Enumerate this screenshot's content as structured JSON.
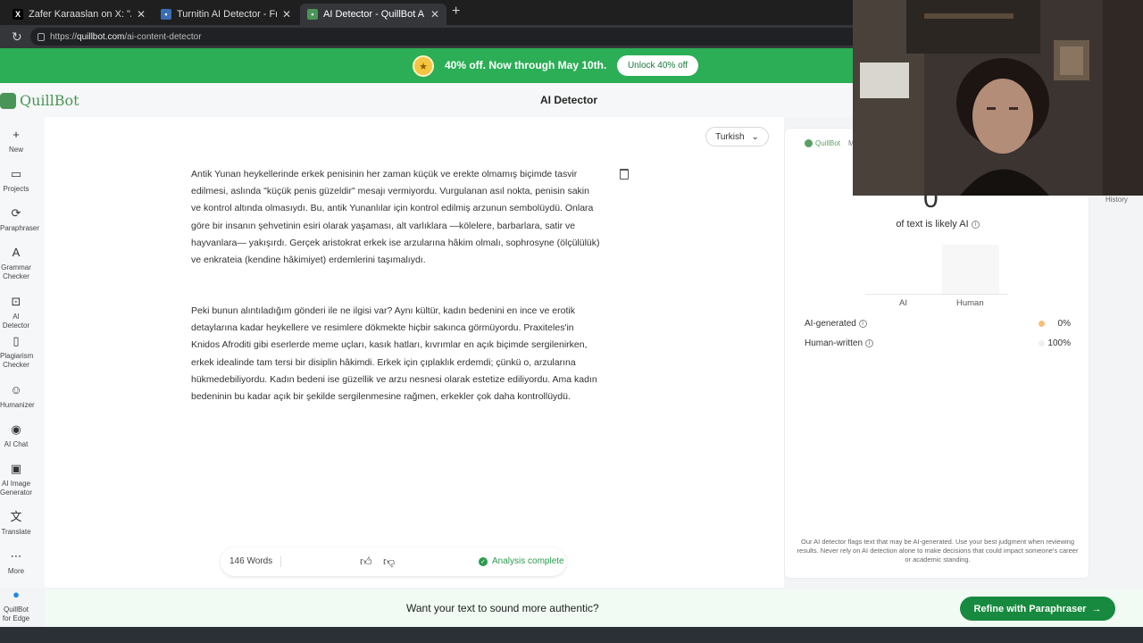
{
  "browser": {
    "tabs": [
      {
        "title": "Zafer Karaaslan on X: \"Antik Yunan",
        "favicon": "x-icon",
        "active": false
      },
      {
        "title": "Turnitin AI Detector - Free & Unlimited",
        "favicon": "doc-icon",
        "active": false
      },
      {
        "title": "AI Detector - QuillBot AI",
        "favicon": "quillbot-icon",
        "active": true
      }
    ],
    "url_prefix": "https://",
    "url_domain": "quillbot.com",
    "url_path": "/ai-content-detector"
  },
  "promo": {
    "text": "40% off. Now through May 10th.",
    "button": "Unlock 40% off"
  },
  "header": {
    "logo": "QuillBot",
    "title": "AI Detector"
  },
  "sidebar": {
    "items": [
      {
        "label": "New",
        "icon": "plus-icon"
      },
      {
        "label": "Projects",
        "icon": "folder-icon"
      },
      {
        "label": "Paraphraser",
        "icon": "paraphrase-icon"
      },
      {
        "label": "Grammar Checker",
        "icon": "grammar-icon"
      },
      {
        "label": "AI Detector",
        "icon": "detector-icon"
      },
      {
        "label": "Plagiarism Checker",
        "icon": "plagiarism-icon"
      },
      {
        "label": "Humanizer",
        "icon": "humanizer-icon"
      },
      {
        "label": "AI Chat",
        "icon": "chat-icon"
      },
      {
        "label": "AI Image Generator",
        "icon": "image-icon"
      },
      {
        "label": "Translate",
        "icon": "translate-icon"
      },
      {
        "label": "More",
        "icon": "more-icon"
      },
      {
        "label": "QuillBot for Edge",
        "icon": "edge-icon"
      }
    ]
  },
  "editor": {
    "language": "Turkish",
    "paragraphs": [
      "Antik Yunan heykellerinde erkek penisinin her zaman küçük ve erekte olmamış biçimde tasvir edilmesi, aslında \"küçük penis güzeldir\" mesajı vermiyordu. Vurgulanan asıl nokta, penisin sakin ve kontrol altında olmasıydı. Bu, antik Yunanlılar için kontrol edilmiş arzunun sembolüydü. Onlara göre bir insanın şehvetinin esiri olarak yaşaması, alt varlıklara —kölelere, barbarlara, satir ve hayvanlara— yakışırdı. Gerçek aristokrat erkek ise arzularına hâkim olmalı, sophrosyne (ölçülülük) ve enkrateia (kendine hâkimiyet) erdemlerini taşımalıydı.",
      "Peki bunun alıntıladığım gönderi ile ne ilgisi var? Aynı kültür, kadın bedenini en ince ve erotik detaylarına kadar heykellere ve resimlere dökmekte hiçbir sakınca görmüyordu. Praxiteles'in Knidos Afroditi gibi eserlerde meme uçları, kasık hatları, kıvrımlar en açık biçimde sergilenirken, erkek idealinde tam tersi bir disiplin hâkimdi. Erkek için çıplaklık erdemdi; çünkü o, arzularına hükmedebiliyordu. Kadın bedeni ise güzellik ve arzu nesnesi olarak estetize ediliyordu. Ama kadın bedeninin bu kadar açık bir şekilde sergilenmesine rağmen, erkekler çok daha kontrollüydü."
    ],
    "word_count": "146 Words",
    "status": "Analysis complete"
  },
  "result": {
    "brand": "QuillBot",
    "brand_cut": "M",
    "ai_percent": "0",
    "likely_label": "of text is likely AI",
    "chart_labels": {
      "ai": "AI",
      "human": "Human"
    },
    "rows": [
      {
        "label": "AI-generated",
        "value": "0%",
        "color": "#f5c07a"
      },
      {
        "label": "Human-written",
        "value": "100%",
        "color": "#efefef"
      }
    ],
    "disclaimer": "Our AI detector flags text that may be AI-generated. Use your best judgment when reviewing results. Never rely on AI detection alone to make decisions that could impact someone's career or academic standing."
  },
  "history": "History",
  "footer": {
    "question": "Want your text to sound more authentic?",
    "button": "Refine with Paraphraser"
  },
  "colors": {
    "brand_green": "#2bae55",
    "cta_green": "#188a3f",
    "ai_orange": "#f5c07a"
  }
}
